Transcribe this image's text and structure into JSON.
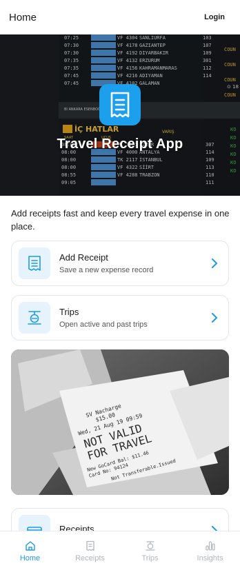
{
  "topbar": {
    "title": "Home",
    "login_label": "Login"
  },
  "hero": {
    "app_title": "Travel Receipt App",
    "board": {
      "rows_top": [
        [
          "07:25",
          "VF 4304",
          "SANLIURFA",
          "103"
        ],
        [
          "07:30",
          "VF 4178",
          "GAZIANTEP",
          "107"
        ],
        [
          "07:30",
          "VF 4192",
          "DIYARBAKIR",
          "109"
        ],
        [
          "07:35",
          "VF 4132",
          "ERZURUM",
          "301"
        ],
        [
          "07:35",
          "VF 4156",
          "KAHRAMANMARAS",
          "112"
        ],
        [
          "07:45",
          "VF 4216",
          "ADIYAMAN",
          "114"
        ],
        [
          "07:45",
          "VF 4102",
          "GALAMAN",
          ""
        ]
      ],
      "side_labels": [
        "COUN",
        "COUN",
        "COUN",
        "COUN"
      ],
      "clock": "⊙ 18",
      "ankara": "BI ANKARA ESENBOĞA",
      "section_title": "İÇ HATLAR",
      "header_time": "SAAT",
      "header_flight": "UÇUŞ",
      "header_dest": "VARIŞ",
      "rows_bottom": [
        [
          "08:00",
          "PC 3161",
          "İZMİR",
          "307"
        ],
        [
          "08:00",
          "VF 4000",
          "ANTALYA",
          "114"
        ],
        [
          "08:00",
          "TK 2117",
          "İSTANBUL",
          "109"
        ],
        [
          "08:00",
          "VF 4322",
          "SİİRT",
          "113"
        ],
        [
          "08:55",
          "VF 4288",
          "TRABZON",
          "110"
        ],
        [
          "09:05",
          "",
          "",
          "111"
        ]
      ],
      "right_labels": [
        "KO",
        "KO",
        "KO",
        "KO",
        "KO",
        "KO"
      ]
    }
  },
  "intro": "Add receipts fast and keep every travel expense in one place.",
  "cards": [
    {
      "title": "Add Receipt",
      "subtitle": "Save a new expense record"
    },
    {
      "title": "Trips",
      "subtitle": "Open active and past trips"
    },
    {
      "title": "Receipts",
      "subtitle": ""
    }
  ],
  "photo": {
    "lines": [
      "SV Nacharge",
      "$15.00",
      "Wed, 21 Aug 19 09:59",
      "NOT VALID",
      "FOR TRAVEL",
      "New GoCard Bal: $11.46",
      "Card No: 94124",
      "Not Transferable.Issued"
    ]
  },
  "tabs": [
    {
      "label": "Home",
      "active": true
    },
    {
      "label": "Receipts",
      "active": false
    },
    {
      "label": "Trips",
      "active": false
    },
    {
      "label": "Insights",
      "active": false
    }
  ],
  "colors": {
    "accent": "#1c9be8",
    "tab_inactive": "#b2b6bb",
    "icon_bg": "#e6f3fc"
  }
}
